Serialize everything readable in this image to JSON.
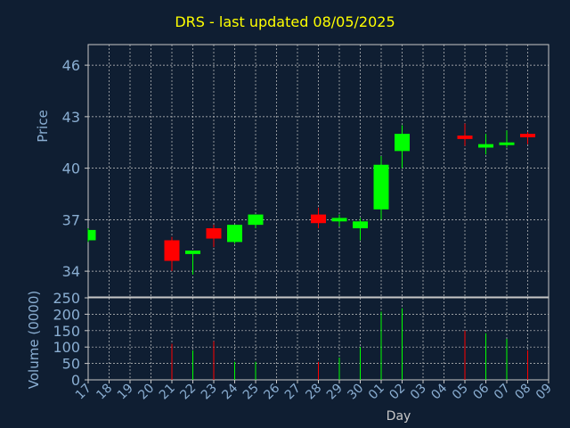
{
  "chart_data": {
    "type": "candlestick",
    "title": "DRS - last updated 08/05/2025",
    "ylabel_price": "Price",
    "ylabel_volume": "Volume (0000)",
    "xlabel": "Day",
    "price_ylim": [
      32.5,
      47.2
    ],
    "price_ticks": [
      34,
      37,
      40,
      43,
      46
    ],
    "volume_ylim": [
      0,
      250
    ],
    "volume_ticks": [
      0,
      50,
      100,
      150,
      200,
      250
    ],
    "days": [
      "17",
      "18",
      "19",
      "20",
      "21",
      "22",
      "23",
      "24",
      "25",
      "26",
      "27",
      "28",
      "29",
      "30",
      "01",
      "02",
      "03",
      "04",
      "05",
      "06",
      "07",
      "08",
      "09"
    ],
    "candles": [
      {
        "day": "17",
        "open": 35.8,
        "high": 36.5,
        "low": 35.7,
        "close": 36.4,
        "volume": 0
      },
      {
        "day": "21",
        "open": 35.8,
        "high": 36.0,
        "low": 34.0,
        "close": 34.6,
        "volume": 110
      },
      {
        "day": "22",
        "open": 35.0,
        "high": 35.1,
        "low": 33.8,
        "close": 35.2,
        "volume": 90
      },
      {
        "day": "23",
        "open": 36.5,
        "high": 36.7,
        "low": 35.4,
        "close": 35.9,
        "volume": 118
      },
      {
        "day": "24",
        "open": 35.7,
        "high": 36.7,
        "low": 35.6,
        "close": 36.7,
        "volume": 55
      },
      {
        "day": "25",
        "open": 36.7,
        "high": 37.3,
        "low": 36.5,
        "close": 37.3,
        "volume": 55
      },
      {
        "day": "28",
        "open": 37.3,
        "high": 37.7,
        "low": 36.5,
        "close": 36.8,
        "volume": 55
      },
      {
        "day": "29",
        "open": 36.9,
        "high": 37.3,
        "low": 36.6,
        "close": 37.1,
        "volume": 68
      },
      {
        "day": "30",
        "open": 36.5,
        "high": 37.1,
        "low": 35.8,
        "close": 36.9,
        "volume": 100
      },
      {
        "day": "01",
        "open": 37.6,
        "high": 40.7,
        "low": 37.0,
        "close": 40.2,
        "volume": 208
      },
      {
        "day": "02",
        "open": 41.0,
        "high": 42.5,
        "low": 40.0,
        "close": 42.0,
        "volume": 218
      },
      {
        "day": "05",
        "open": 41.9,
        "high": 42.6,
        "low": 41.3,
        "close": 41.7,
        "volume": 150
      },
      {
        "day": "06",
        "open": 41.2,
        "high": 42.0,
        "low": 40.8,
        "close": 41.4,
        "volume": 142
      },
      {
        "day": "07",
        "open": 41.5,
        "high": 42.2,
        "low": 41.2,
        "close": 41.5,
        "volume": 125
      },
      {
        "day": "08",
        "open": 42.0,
        "high": 42.1,
        "low": 41.4,
        "close": 41.8,
        "volume": 90
      }
    ],
    "colors": {
      "background": "#0f1e32",
      "plot_background": "#0f1e32",
      "up": "#00ff00",
      "down": "#ff0000",
      "grid": "#c8c8c8",
      "axis": "#c8c8c8",
      "label": "#8aaed2",
      "title": "#ffff00"
    },
    "grid": true
  }
}
